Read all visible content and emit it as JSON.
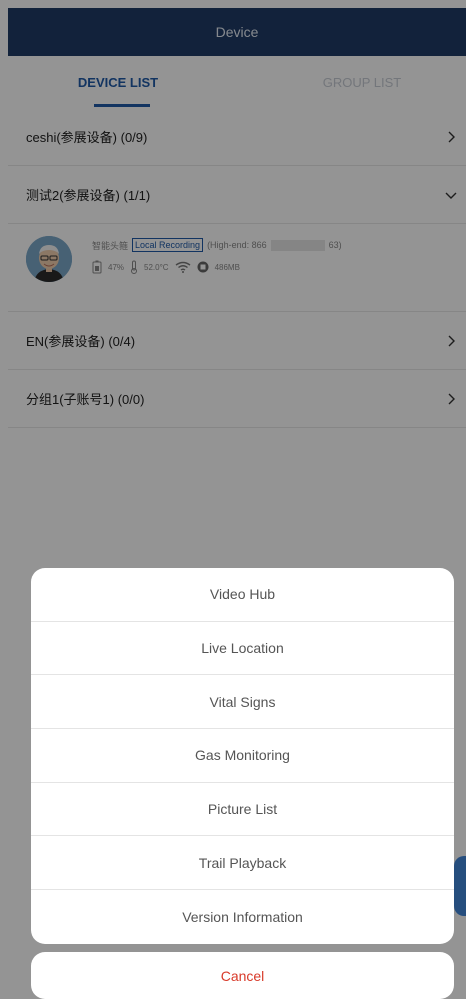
{
  "header": {
    "title": "Device"
  },
  "tabs": {
    "device": "DEVICE LIST",
    "group": "GROUP LIST"
  },
  "groups": [
    {
      "label": "ceshi(参展设备) (0/9)",
      "expanded": false
    },
    {
      "label": "测试2(参展设备) (1/1)",
      "expanded": true
    },
    {
      "label": "EN(参展设备) (0/4)",
      "expanded": false
    },
    {
      "label": "分组1(子账号1) (0/0)",
      "expanded": false
    }
  ],
  "device": {
    "name": "智能头箍",
    "recording": "Local Recording",
    "id_prefix": "(High-end: 866",
    "id_suffix": "63)",
    "battery": "47%",
    "temperature": "52.0°C",
    "storage": "486MB"
  },
  "menu": {
    "items": [
      "Video Hub",
      "Live Location",
      "Vital Signs",
      "Gas Monitoring",
      "Picture List",
      "Trail Playback",
      "Version Information"
    ],
    "cancel": "Cancel"
  },
  "colors": {
    "header_bg": "#1f3b66",
    "accent": "#1f5aa8",
    "cancel": "#d83a2a"
  }
}
